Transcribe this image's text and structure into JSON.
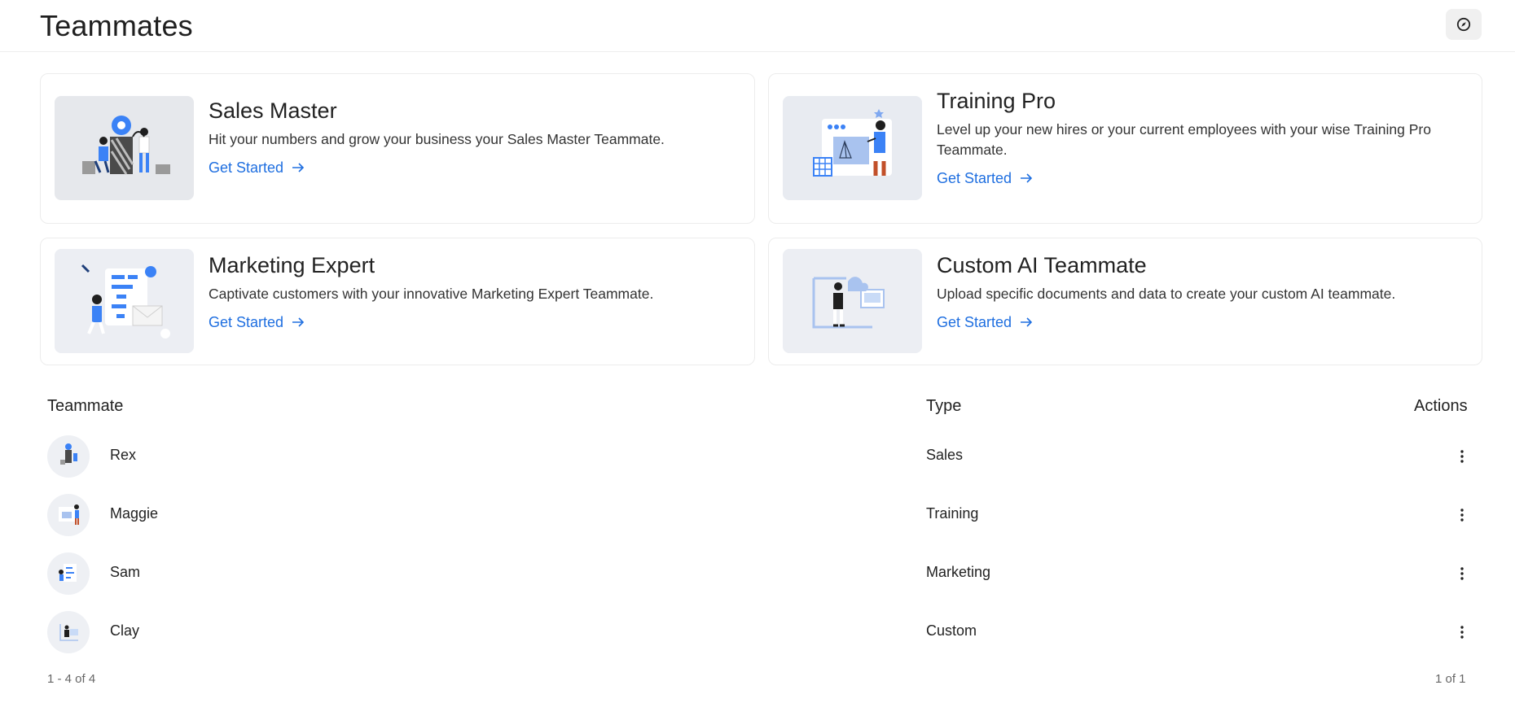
{
  "header": {
    "title": "Teammates",
    "explore_icon": "compass-icon"
  },
  "cards": [
    {
      "title": "Sales Master",
      "description": "Hit your numbers and grow your business your Sales Master Teammate.",
      "cta": "Get Started"
    },
    {
      "title": "Training Pro",
      "description": "Level up your new hires or your current employees with your wise Training Pro Teammate.",
      "cta": "Get Started"
    },
    {
      "title": "Marketing Expert",
      "description": "Captivate customers with your innovative Marketing Expert Teammate.",
      "cta": "Get Started"
    },
    {
      "title": "Custom AI Teammate",
      "description": "Upload specific documents and data to create your custom AI teammate.",
      "cta": "Get Started"
    }
  ],
  "table": {
    "columns": {
      "teammate": "Teammate",
      "type": "Type",
      "actions": "Actions"
    },
    "rows": [
      {
        "name": "Rex",
        "type": "Sales"
      },
      {
        "name": "Maggie",
        "type": "Training"
      },
      {
        "name": "Sam",
        "type": "Marketing"
      },
      {
        "name": "Clay",
        "type": "Custom"
      }
    ],
    "range": "1 - 4 of 4",
    "page": "1 of 1"
  },
  "colors": {
    "link": "#1f6fe0",
    "card_image_bg": "#e6e8ec",
    "card_image_bg_alt": "#eef0f5",
    "accent_blue": "#3b82f6"
  }
}
